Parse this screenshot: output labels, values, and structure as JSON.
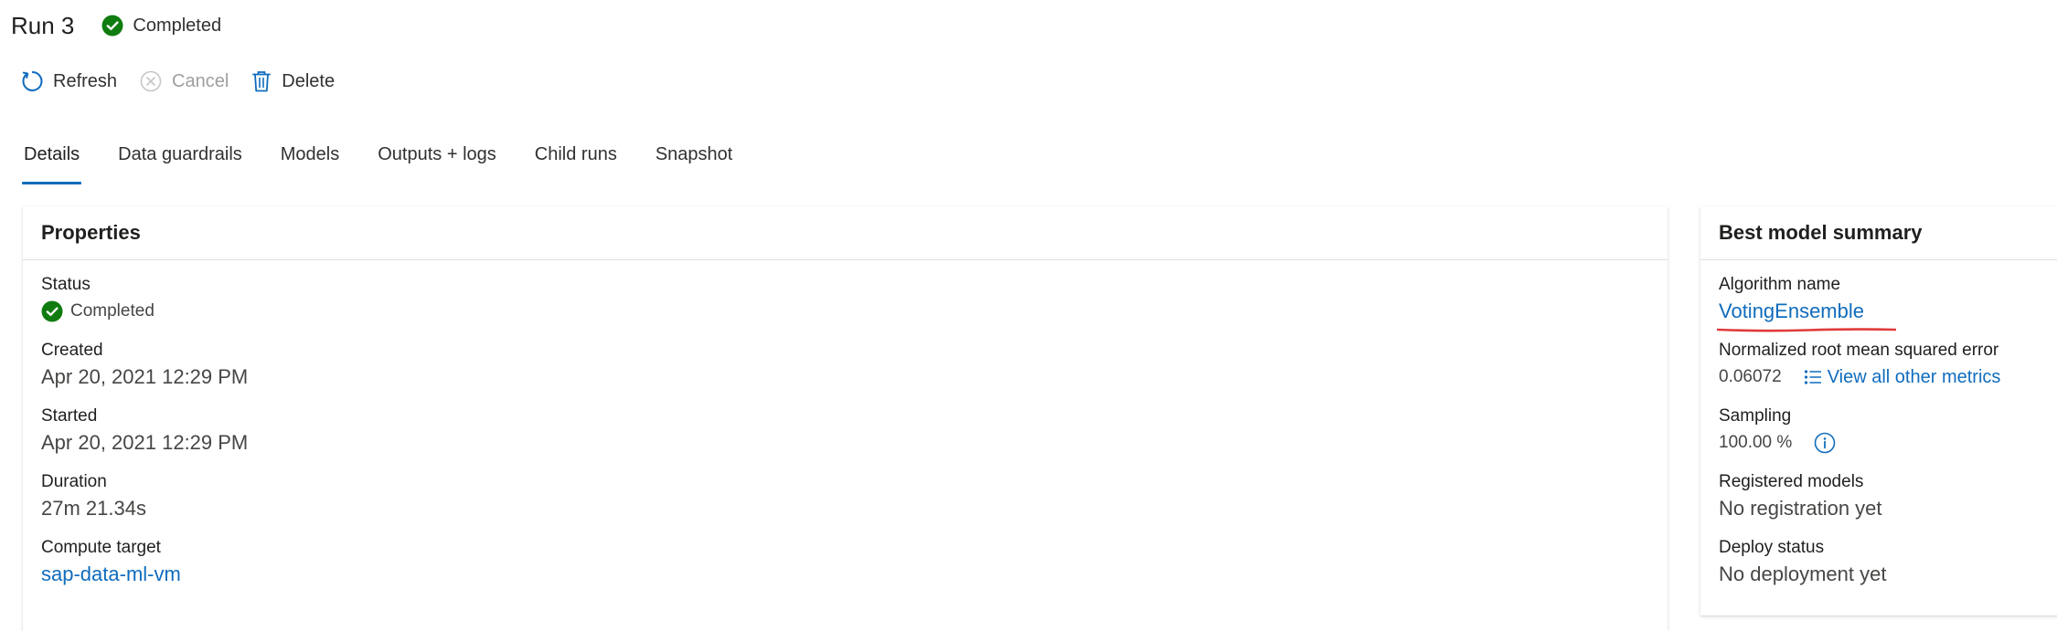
{
  "header": {
    "run_title": "Run 3",
    "status": "Completed",
    "status_icon": "check-circle-icon",
    "status_color": "#107c10"
  },
  "toolbar": {
    "refresh_label": "Refresh",
    "cancel_label": "Cancel",
    "delete_label": "Delete"
  },
  "tabs": [
    {
      "label": "Details",
      "active": true
    },
    {
      "label": "Data guardrails"
    },
    {
      "label": "Models"
    },
    {
      "label": "Outputs + logs"
    },
    {
      "label": "Child runs"
    },
    {
      "label": "Snapshot"
    }
  ],
  "properties": {
    "title": "Properties",
    "status_label": "Status",
    "status_value": "Completed",
    "created_label": "Created",
    "created_value": "Apr 20, 2021 12:29 PM",
    "started_label": "Started",
    "started_value": "Apr 20, 2021 12:29 PM",
    "duration_label": "Duration",
    "duration_value": "27m 21.34s",
    "compute_label": "Compute target",
    "compute_value": "sap-data-ml-vm"
  },
  "best_model": {
    "title": "Best model summary",
    "algorithm_label": "Algorithm name",
    "algorithm_value": "VotingEnsemble",
    "metric_label": "Normalized root mean squared error",
    "metric_value": "0.06072",
    "view_metrics_label": "View all other metrics",
    "sampling_label": "Sampling",
    "sampling_value": "100.00 %",
    "registered_label": "Registered models",
    "registered_value": "No registration yet",
    "deploy_label": "Deploy status",
    "deploy_value": "No deployment yet"
  },
  "colors": {
    "accent": "#0f6cbd",
    "success": "#107c10",
    "annotation": "#e03a3a"
  }
}
